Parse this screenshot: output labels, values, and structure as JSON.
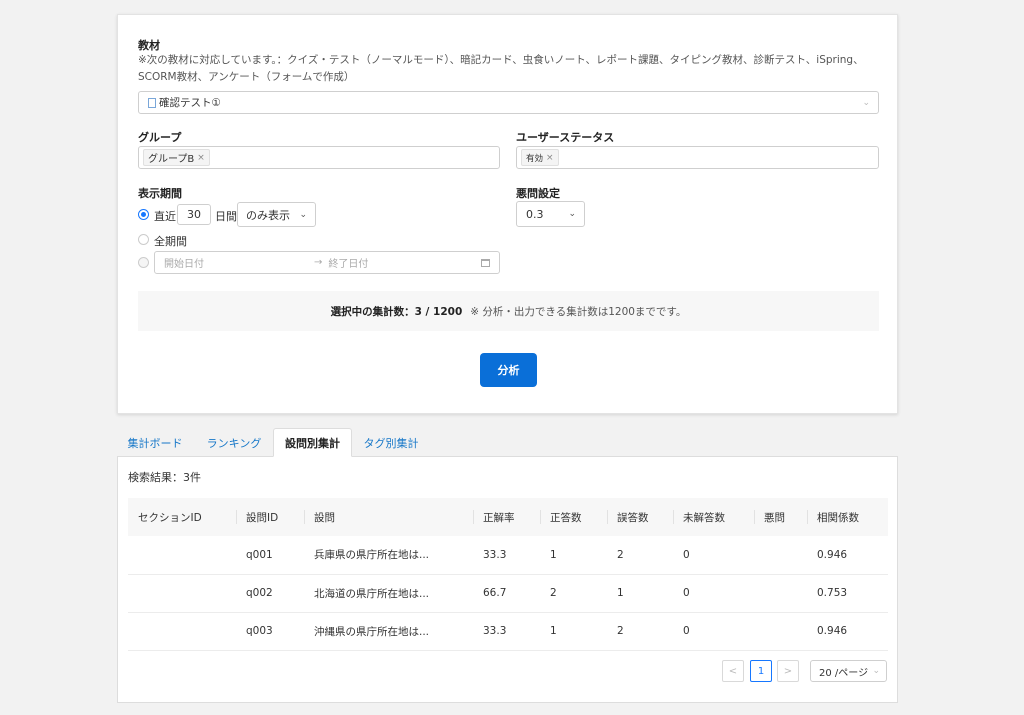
{
  "form": {
    "material_label": "教材",
    "material_note": "※次の教材に対応しています。：クイズ・テスト（ノーマルモード）、暗記カード、虫食いノート、レポート課題、タイピング教材、診断テスト、iSpring、SCORM教材、アンケート（フォームで作成）",
    "material_value": "確認テスト①",
    "group_label": "グループ",
    "group_tag": "グループB",
    "user_status_label": "ユーザーステータス",
    "user_status_tag": "有効",
    "period_label": "表示期間",
    "period_recent_prefix": "直近",
    "period_days": "30",
    "period_unit": "日間",
    "period_mode": "のみ表示",
    "period_all": "全期間",
    "start_placeholder": "開始日付",
    "end_placeholder": "終了日付",
    "range_arrow": "→",
    "bad_q_label": "悪問設定",
    "bad_q_value": "0.3",
    "selected_count_text": "選択中の集計数：3 / 1200",
    "selected_count_note": "※ 分析・出力できる集計数は1200までです。",
    "analyze_button": "分析"
  },
  "tabs": [
    "集計ボード",
    "ランキング",
    "設問別集計",
    "タグ別集計"
  ],
  "results": {
    "count_text": "検索結果：3件",
    "columns": [
      "セクションID",
      "設問ID",
      "設問",
      "正解率",
      "正答数",
      "誤答数",
      "未解答数",
      "悪問",
      "相関係数"
    ],
    "rows": [
      [
        "",
        "q001",
        "兵庫県の県庁所在地は...",
        "33.3",
        "1",
        "2",
        "0",
        "",
        "0.946"
      ],
      [
        "",
        "q002",
        "北海道の県庁所在地は...",
        "66.7",
        "2",
        "1",
        "0",
        "",
        "0.753"
      ],
      [
        "",
        "q003",
        "沖縄県の県庁所在地は...",
        "33.3",
        "1",
        "2",
        "0",
        "",
        "0.946"
      ]
    ]
  },
  "pagination": {
    "current": "1",
    "page_size": "20 /ページ",
    "prev": "<",
    "next": ">"
  },
  "colors": {
    "accent": "#0a6fd8",
    "link": "#1677c8",
    "background": "#f2f2f2"
  },
  "icons": {
    "document": "document-icon",
    "calendar": "calendar-icon",
    "chevron": "chevron-down-icon"
  }
}
